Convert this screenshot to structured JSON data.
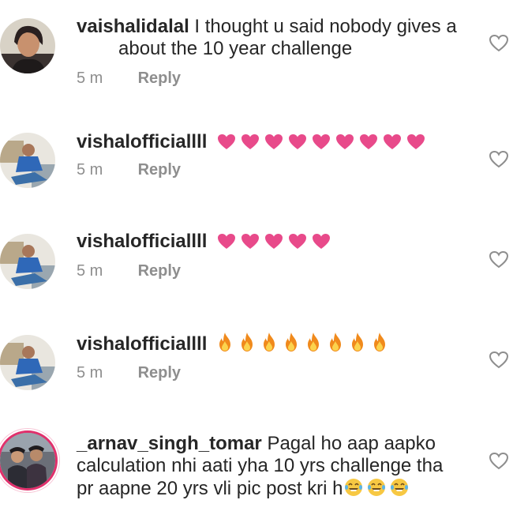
{
  "comments": [
    {
      "username": "vaishalidalal",
      "text_line1": "I thought u said nobody gives a",
      "text_line2": "about the 10 year challenge",
      "time": "5 m",
      "reply_label": "Reply",
      "emoji": "",
      "emoji_count": 0
    },
    {
      "username": "vishalofficiallll",
      "text_line1": "",
      "time": "5 m",
      "reply_label": "Reply",
      "emoji": "pink-heart",
      "emoji_count": 9
    },
    {
      "username": "vishalofficiallll",
      "text_line1": "",
      "time": "5 m",
      "reply_label": "Reply",
      "emoji": "pink-heart",
      "emoji_count": 5
    },
    {
      "username": "vishalofficiallll",
      "text_line1": "",
      "time": "5 m",
      "reply_label": "Reply",
      "emoji": "fire",
      "emoji_count": 8
    },
    {
      "username": "_arnav_singh_tomar",
      "text_line1": "Pagal ho aap aapko",
      "text_line2": "calculation nhi aati yha 10 yrs challenge tha",
      "text_line3": "pr aapne 20 yrs vli pic post kri h",
      "emoji": "laughing-tears",
      "emoji_count": 3
    }
  ],
  "icons": {
    "like": "heart-outline-icon"
  },
  "colors": {
    "heart": "#e84a8a",
    "fire_outer": "#f08a1c",
    "fire_inner": "#fcd34d",
    "meta": "#8e8e8e",
    "text": "#262626",
    "story_ring": "#e1306c"
  }
}
